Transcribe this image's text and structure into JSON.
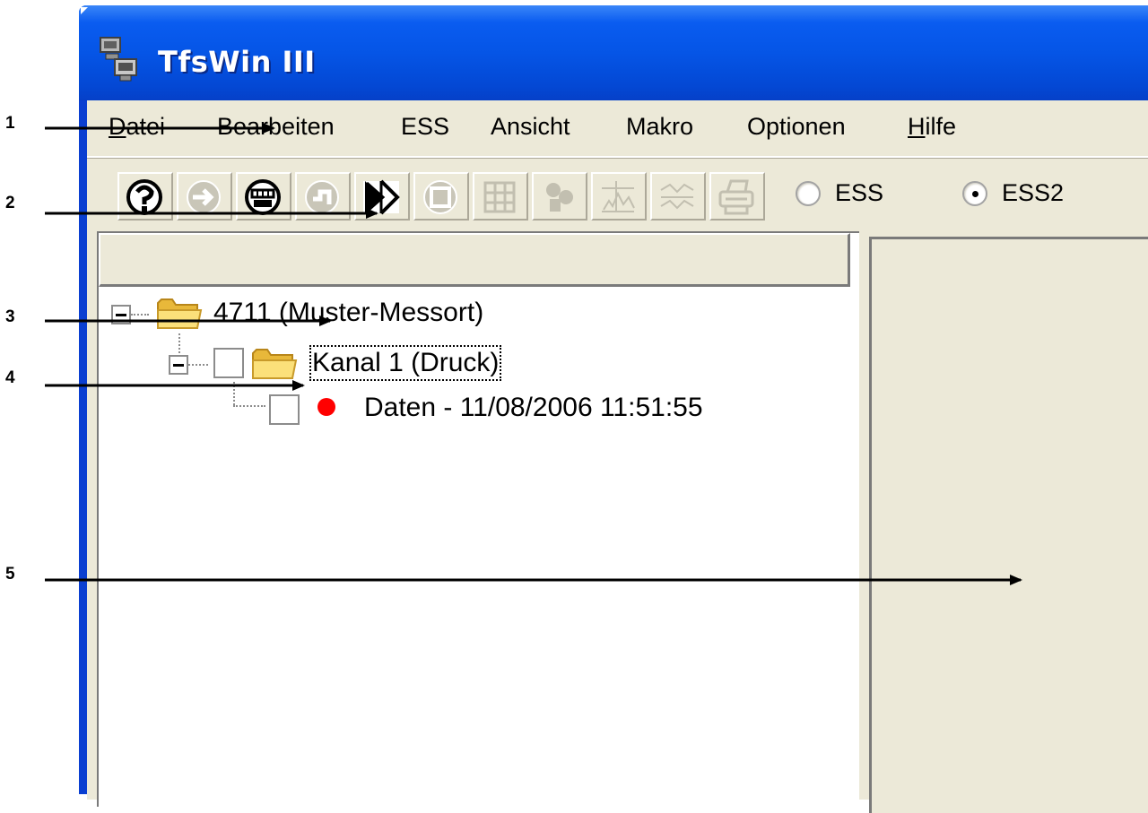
{
  "window": {
    "title": "TfsWin III"
  },
  "menu": {
    "items": [
      {
        "label": "Datei",
        "accel_index": 0
      },
      {
        "label": "Bearbeiten"
      },
      {
        "label": "ESS"
      },
      {
        "label": "Ansicht"
      },
      {
        "label": "Makro"
      },
      {
        "label": "Optionen"
      },
      {
        "label": "Hilfe",
        "accel_index": 0
      }
    ]
  },
  "toolbar": {
    "buttons": [
      {
        "icon": "help-icon",
        "enabled": true
      },
      {
        "icon": "import-icon",
        "enabled": false
      },
      {
        "icon": "communication-icon",
        "enabled": true
      },
      {
        "icon": "export-icon",
        "enabled": false
      },
      {
        "icon": "zoom-icon",
        "enabled": true
      },
      {
        "icon": "info-icon",
        "enabled": false
      },
      {
        "icon": "table-icon",
        "enabled": false
      },
      {
        "icon": "statistics-icon",
        "enabled": false
      },
      {
        "icon": "chart-icon",
        "enabled": false
      },
      {
        "icon": "wave-icon",
        "enabled": false
      },
      {
        "icon": "print-icon",
        "enabled": false
      }
    ],
    "radios": [
      {
        "label": "ESS",
        "checked": false
      },
      {
        "label": "ESS2",
        "checked": true
      }
    ]
  },
  "tree": {
    "root": {
      "label": "4711 (Muster-Messort)"
    },
    "channel": {
      "label": "Kanal 1 (Druck)"
    },
    "data": {
      "label": "Daten - 11/08/2006 11:51:55",
      "status_color": "#ff0000"
    }
  },
  "callouts": [
    "1",
    "2",
    "3",
    "4",
    "5"
  ]
}
